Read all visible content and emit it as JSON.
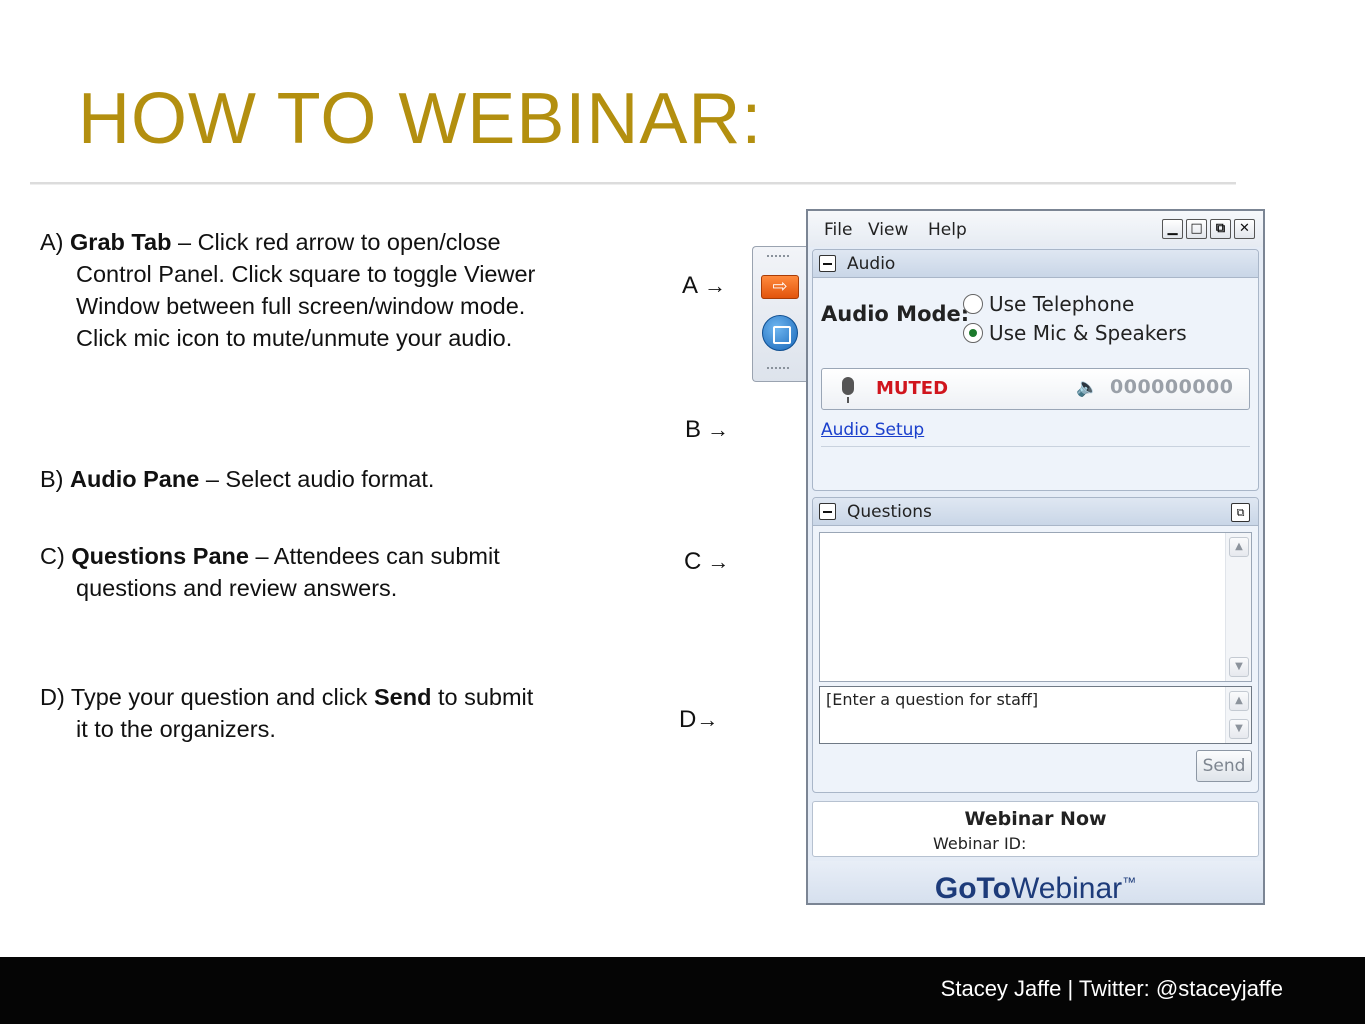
{
  "slide": {
    "title": "HOW TO WEBINAR:",
    "steps": [
      {
        "letter": "A)",
        "term": "Grab Tab",
        "text": " – Click red arrow to open/close Control Panel. Click square to toggle Viewer Window between full screen/window mode. Click mic icon to mute/unmute your audio."
      },
      {
        "letter": "B)",
        "term": "Audio Pane",
        "text": " – Select audio format."
      },
      {
        "letter": "C)",
        "term": "Questions Pane",
        "text": " – Attendees can submit questions and review answers."
      },
      {
        "letter": "D)",
        "pre": "Type your question and click ",
        "term": "Send",
        "text": " to submit it to the organizers."
      }
    ],
    "markers": [
      "A",
      "B",
      "C",
      "D"
    ],
    "marker_arrow": "→",
    "footer": "Stacey Jaffe  |   Twitter: @staceyjaffe"
  },
  "control_panel": {
    "grab_tab": {
      "arrow_glyph": "⇨"
    },
    "menu": [
      "File",
      "View",
      "Help"
    ],
    "window_buttons": [
      "▁",
      "□",
      "⧉",
      "✕"
    ],
    "audio": {
      "title": "Audio",
      "mode_label": "Audio Mode:",
      "options": [
        "Use Telephone",
        "Use Mic & Speakers"
      ],
      "selected": "Use Mic & Speakers",
      "status": "MUTED",
      "level": "000000000",
      "setup_link": "Audio Setup"
    },
    "questions": {
      "title": "Questions",
      "placeholder": "[Enter a question for staff]",
      "send_label": "Send"
    },
    "webinar_name": "Webinar Now",
    "webinar_id_label": "Webinar ID:",
    "brand_bold": "GoTo",
    "brand_light": "Webinar",
    "brand_mark": "™"
  },
  "colors": {
    "title": "#b38f0f",
    "muted": "#d0151d",
    "link": "#1a3fcc",
    "footer_bg": "#050505"
  },
  "icons": [
    "orange-arrow-icon",
    "blue-square-icon",
    "mic-icon",
    "speaker-icon",
    "popout-icon"
  ]
}
